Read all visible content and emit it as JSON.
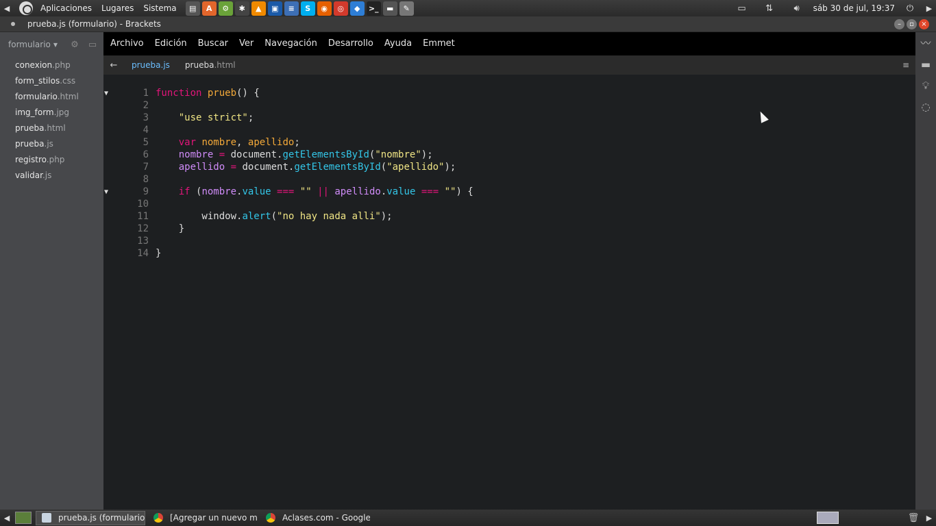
{
  "top_panel": {
    "menus": [
      "Aplicaciones",
      "Lugares",
      "Sistema"
    ],
    "launchers": [
      {
        "icon": "printer-icon",
        "color": "#555555",
        "glyph": "▤"
      },
      {
        "icon": "software-center-icon",
        "color": "#e2662c",
        "glyph": "A"
      },
      {
        "icon": "ubuntu-tweak-icon",
        "color": "#6aa339",
        "glyph": "⚙"
      },
      {
        "icon": "system-settings-icon",
        "color": "#444444",
        "glyph": "✱"
      },
      {
        "icon": "vlc-icon",
        "color": "#f08a00",
        "glyph": "▲"
      },
      {
        "icon": "virtualbox-icon",
        "color": "#1b5aa8",
        "glyph": "▣"
      },
      {
        "icon": "text-document-icon",
        "color": "#3d6fb5",
        "glyph": "≡"
      },
      {
        "icon": "skype-icon",
        "color": "#00aff0",
        "glyph": "S"
      },
      {
        "icon": "firefox-icon",
        "color": "#e66000",
        "glyph": "◉"
      },
      {
        "icon": "chrome-icon",
        "color": "#d33a2c",
        "glyph": "◎"
      },
      {
        "icon": "dropbox-icon",
        "color": "#2e7ed6",
        "glyph": "◆"
      },
      {
        "icon": "terminal-icon",
        "color": "#222222",
        "glyph": ">_"
      },
      {
        "icon": "scanner-icon",
        "color": "#555555",
        "glyph": "▬"
      },
      {
        "icon": "text-editor-icon",
        "color": "#777777",
        "glyph": "✎"
      }
    ],
    "clock": "sáb 30 de jul, 19:37"
  },
  "window": {
    "title": "prueba.js (formulario) - Brackets"
  },
  "sidebar": {
    "project": "formulario",
    "files": [
      {
        "name": "conexion",
        "ext": ".php"
      },
      {
        "name": "form_stilos",
        "ext": ".css"
      },
      {
        "name": "formulario",
        "ext": ".html"
      },
      {
        "name": "img_form",
        "ext": ".jpg"
      },
      {
        "name": "prueba",
        "ext": ".html"
      },
      {
        "name": "prueba",
        "ext": ".js"
      },
      {
        "name": "registro",
        "ext": ".php"
      },
      {
        "name": "validar",
        "ext": ".js"
      }
    ]
  },
  "menubar": [
    "Archivo",
    "Edición",
    "Buscar",
    "Ver",
    "Navegación",
    "Desarrollo",
    "Ayuda",
    "Emmet"
  ],
  "tabs": [
    {
      "name": "prueba",
      "ext": ".js",
      "active": true
    },
    {
      "name": "prueba",
      "ext": ".html",
      "active": false
    }
  ],
  "editor": {
    "lines": [
      {
        "n": "1",
        "fold": "▼",
        "tokens": [
          [
            "kw",
            "function"
          ],
          [
            "plain",
            " "
          ],
          [
            "fn",
            "prueb"
          ],
          [
            "plain",
            "() {"
          ]
        ]
      },
      {
        "n": "2",
        "fold": "",
        "tokens": []
      },
      {
        "n": "3",
        "fold": "",
        "tokens": [
          [
            "plain",
            "    "
          ],
          [
            "str",
            "\"use strict\""
          ],
          [
            "plain",
            ";"
          ]
        ]
      },
      {
        "n": "4",
        "fold": "",
        "tokens": []
      },
      {
        "n": "5",
        "fold": "",
        "tokens": [
          [
            "plain",
            "    "
          ],
          [
            "kw",
            "var"
          ],
          [
            "plain",
            " "
          ],
          [
            "fn",
            "nombre"
          ],
          [
            "plain",
            ", "
          ],
          [
            "fn",
            "apellido"
          ],
          [
            "plain",
            ";"
          ]
        ]
      },
      {
        "n": "6",
        "fold": "",
        "tokens": [
          [
            "plain",
            "    "
          ],
          [
            "var",
            "nombre"
          ],
          [
            "plain",
            " "
          ],
          [
            "op",
            "="
          ],
          [
            "plain",
            " document."
          ],
          [
            "prop",
            "getElementsById"
          ],
          [
            "plain",
            "("
          ],
          [
            "str",
            "\"nombre\""
          ],
          [
            "plain",
            ");"
          ]
        ]
      },
      {
        "n": "7",
        "fold": "",
        "tokens": [
          [
            "plain",
            "    "
          ],
          [
            "var",
            "apellido"
          ],
          [
            "plain",
            " "
          ],
          [
            "op",
            "="
          ],
          [
            "plain",
            " document."
          ],
          [
            "prop",
            "getElementsById"
          ],
          [
            "plain",
            "("
          ],
          [
            "str",
            "\"apellido\""
          ],
          [
            "plain",
            ");"
          ]
        ]
      },
      {
        "n": "8",
        "fold": "",
        "tokens": []
      },
      {
        "n": "9",
        "fold": "▼",
        "tokens": [
          [
            "plain",
            "    "
          ],
          [
            "kw",
            "if"
          ],
          [
            "plain",
            " ("
          ],
          [
            "var",
            "nombre"
          ],
          [
            "plain",
            "."
          ],
          [
            "prop",
            "value"
          ],
          [
            "plain",
            " "
          ],
          [
            "op",
            "==="
          ],
          [
            "plain",
            " "
          ],
          [
            "str",
            "\"\""
          ],
          [
            "plain",
            " "
          ],
          [
            "op",
            "||"
          ],
          [
            "plain",
            " "
          ],
          [
            "var",
            "apellido"
          ],
          [
            "plain",
            "."
          ],
          [
            "prop",
            "value"
          ],
          [
            "plain",
            " "
          ],
          [
            "op",
            "==="
          ],
          [
            "plain",
            " "
          ],
          [
            "str",
            "\"\""
          ],
          [
            "plain",
            ") {"
          ]
        ]
      },
      {
        "n": "10",
        "fold": "",
        "tokens": []
      },
      {
        "n": "11",
        "fold": "",
        "tokens": [
          [
            "plain",
            "        window."
          ],
          [
            "prop",
            "alert"
          ],
          [
            "plain",
            "("
          ],
          [
            "str",
            "\"no hay nada alli\""
          ],
          [
            "plain",
            ");"
          ]
        ]
      },
      {
        "n": "12",
        "fold": "",
        "tokens": [
          [
            "plain",
            "    }"
          ]
        ]
      },
      {
        "n": "13",
        "fold": "",
        "tokens": []
      },
      {
        "n": "14",
        "fold": "",
        "tokens": [
          [
            "plain",
            "}"
          ]
        ]
      }
    ]
  },
  "taskbar": {
    "tasks": [
      {
        "label": "prueba.js (formulario) -...",
        "icon": "brackets-window-icon",
        "active": true
      },
      {
        "label": "[Agregar un nuevo me...",
        "icon": "chrome-icon",
        "active": false
      },
      {
        "label": "Aclases.com - Google C...",
        "icon": "chrome-icon",
        "active": false
      }
    ]
  }
}
